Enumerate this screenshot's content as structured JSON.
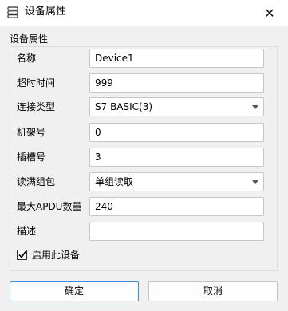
{
  "window": {
    "title": "设备属性",
    "close_glyph": "✕",
    "icon": "stacked-list-icon"
  },
  "group": {
    "title": "设备属性"
  },
  "fields": {
    "name": {
      "label": "名称",
      "value": "Device1"
    },
    "timeout": {
      "label": "超时时间",
      "value": "999"
    },
    "connection_type": {
      "label": "连接类型",
      "value": "S7 BASIC(3)"
    },
    "rack": {
      "label": "机架号",
      "value": "0"
    },
    "slot": {
      "label": "插槽号",
      "value": "3"
    },
    "read_write_group": {
      "label": "读满组包",
      "value": "单组读取"
    },
    "max_apdu": {
      "label": "最大APDU数量",
      "value": "240"
    },
    "description": {
      "label": "描述",
      "value": ""
    }
  },
  "enable_device": {
    "label": "启用此设备",
    "checked": true
  },
  "buttons": {
    "ok": "确定",
    "cancel": "取消"
  },
  "colors": {
    "primary_border": "#3b8ed8"
  }
}
